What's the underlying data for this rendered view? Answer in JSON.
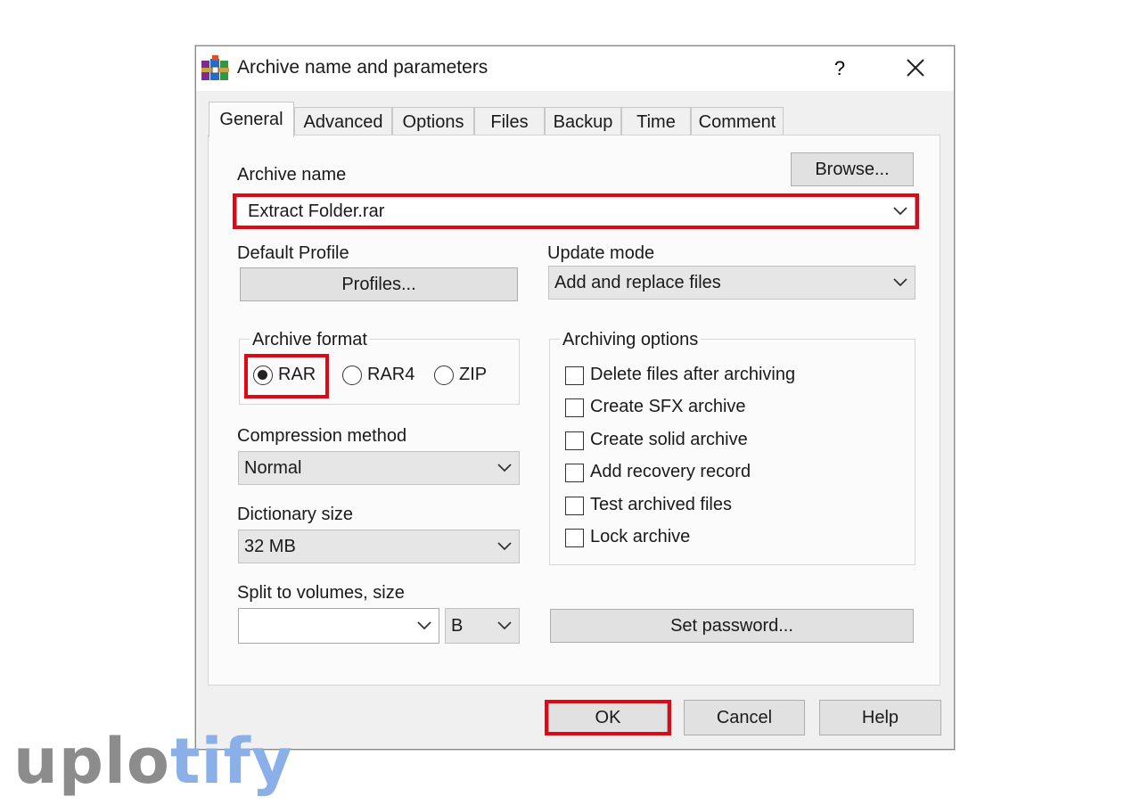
{
  "window": {
    "title": "Archive name and parameters",
    "help": "?"
  },
  "tabs": [
    {
      "label": "General",
      "active": true
    },
    {
      "label": "Advanced"
    },
    {
      "label": "Options"
    },
    {
      "label": "Files"
    },
    {
      "label": "Backup"
    },
    {
      "label": "Time"
    },
    {
      "label": "Comment"
    }
  ],
  "general": {
    "archive_name_label": "Archive name",
    "browse_label": "Browse...",
    "archive_name_value": "Extract Folder.rar",
    "default_profile_label": "Default Profile",
    "profiles_label": "Profiles...",
    "update_mode_label": "Update mode",
    "update_mode_value": "Add and replace files",
    "archive_format_label": "Archive format",
    "formats": [
      {
        "label": "RAR",
        "selected": true
      },
      {
        "label": "RAR4",
        "selected": false
      },
      {
        "label": "ZIP",
        "selected": false
      }
    ],
    "compression_label": "Compression method",
    "compression_value": "Normal",
    "dictionary_label": "Dictionary size",
    "dictionary_value": "32 MB",
    "split_label": "Split to volumes, size",
    "split_value": "",
    "split_unit": "B",
    "archiving_options_label": "Archiving options",
    "options": [
      {
        "label": "Delete files after archiving",
        "checked": false
      },
      {
        "label": "Create SFX archive",
        "checked": false
      },
      {
        "label": "Create solid archive",
        "checked": false
      },
      {
        "label": "Add recovery record",
        "checked": false
      },
      {
        "label": "Test archived files",
        "checked": false
      },
      {
        "label": "Lock archive",
        "checked": false
      }
    ],
    "set_password_label": "Set password..."
  },
  "footer": {
    "ok": "OK",
    "cancel": "Cancel",
    "help": "Help"
  },
  "watermark": {
    "part1": "uplo",
    "part2": "tify"
  },
  "colors": {
    "highlight": "#e30613",
    "dialog_bg": "#f0f0f0",
    "panel_bg": "#fbfbfb",
    "watermark_gray": "#8c8c8c",
    "watermark_blue": "#8bb0e8"
  }
}
